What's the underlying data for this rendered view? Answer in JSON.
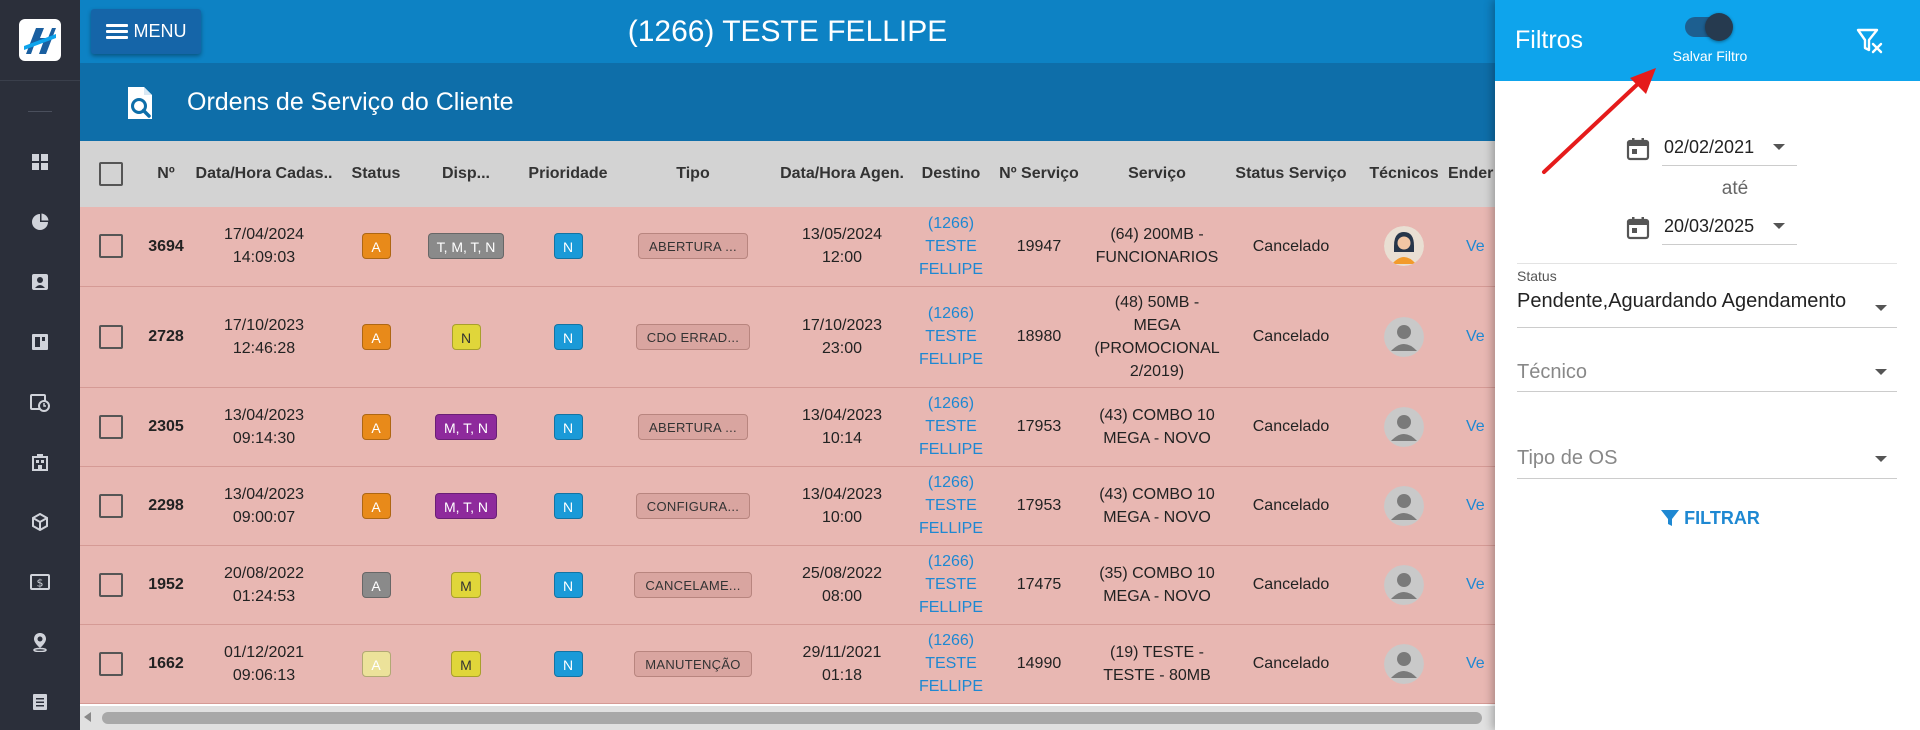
{
  "topbar": {
    "menu_label": "MENU",
    "client_title": "(1266) TESTE FELLIPE",
    "bg_color": "#0d82c4"
  },
  "subheader": {
    "page_title": "Ordens de Serviço do Cliente"
  },
  "sidebar": {
    "icons": [
      "grid-icon",
      "pie-chart-icon",
      "contact-card-icon",
      "dashboard-icon",
      "calendar-clock-icon",
      "building-icon",
      "box-icon",
      "money-icon",
      "map-pin-icon",
      "document-list-icon"
    ]
  },
  "table": {
    "headers": [
      "Nº",
      "Data/Hora Cadas..",
      "Status",
      "Disp...",
      "Prioridade",
      "Tipo",
      "Data/Hora Agen.",
      "Destino",
      "Nº Serviço",
      "Serviço",
      "Status Serviço",
      "Técnicos",
      "Ender"
    ],
    "rows": [
      {
        "num": "3694",
        "cad_date": "17/04/2024",
        "cad_time": "14:09:03",
        "status": "A",
        "status_color": "#e88a1a",
        "disp": "T, M, T, N",
        "disp_bg": "#8a8a8a",
        "disp_fg": "#ffffff",
        "prio": "N",
        "tipo": "ABERTURA ...",
        "ag_date": "13/05/2024",
        "ag_time": "12:00",
        "dest_1": "(1266)",
        "dest_2": "TESTE",
        "dest_3": "FELLIPE",
        "serv_num": "19947",
        "servico_1": "(64) 200MB -",
        "servico_2": "FUNCIONARIOS",
        "servico_3": "",
        "servico_4": "",
        "status_servico": "Cancelado",
        "tecnico_avatar": "woman-avatar",
        "endereco_link": "Ve"
      },
      {
        "num": "2728",
        "cad_date": "17/10/2023",
        "cad_time": "12:46:28",
        "status": "A",
        "status_color": "#e88a1a",
        "disp": "N",
        "disp_bg": "#e0d63a",
        "disp_fg": "#333333",
        "prio": "N",
        "tipo": "CDO ERRAD...",
        "ag_date": "17/10/2023",
        "ag_time": "23:00",
        "dest_1": "(1266)",
        "dest_2": "TESTE",
        "dest_3": "FELLIPE",
        "serv_num": "18980",
        "servico_1": "(48) 50MB -",
        "servico_2": "MEGA",
        "servico_3": "(PROMOCIONAL",
        "servico_4": "2/2019)",
        "status_servico": "Cancelado",
        "tecnico_avatar": "default-avatar",
        "endereco_link": "Ve"
      },
      {
        "num": "2305",
        "cad_date": "13/04/2023",
        "cad_time": "09:14:30",
        "status": "A",
        "status_color": "#e88a1a",
        "disp": "M, T, N",
        "disp_bg": "#8e2a9c",
        "disp_fg": "#ffffff",
        "prio": "N",
        "tipo": "ABERTURA ...",
        "ag_date": "13/04/2023",
        "ag_time": "10:14",
        "dest_1": "(1266)",
        "dest_2": "TESTE",
        "dest_3": "FELLIPE",
        "serv_num": "17953",
        "servico_1": "(43) COMBO 10",
        "servico_2": "MEGA - NOVO",
        "servico_3": "",
        "servico_4": "",
        "status_servico": "Cancelado",
        "tecnico_avatar": "default-avatar",
        "endereco_link": "Ve"
      },
      {
        "num": "2298",
        "cad_date": "13/04/2023",
        "cad_time": "09:00:07",
        "status": "A",
        "status_color": "#e88a1a",
        "disp": "M, T, N",
        "disp_bg": "#8e2a9c",
        "disp_fg": "#ffffff",
        "prio": "N",
        "tipo": "CONFIGURA...",
        "ag_date": "13/04/2023",
        "ag_time": "10:00",
        "dest_1": "(1266)",
        "dest_2": "TESTE",
        "dest_3": "FELLIPE",
        "serv_num": "17953",
        "servico_1": "(43) COMBO 10",
        "servico_2": "MEGA - NOVO",
        "servico_3": "",
        "servico_4": "",
        "status_servico": "Cancelado",
        "tecnico_avatar": "default-avatar",
        "endereco_link": "Ve"
      },
      {
        "num": "1952",
        "cad_date": "20/08/2022",
        "cad_time": "01:24:53",
        "status": "A",
        "status_color": "#8a8a8a",
        "disp": "M",
        "disp_bg": "#e0d63a",
        "disp_fg": "#333333",
        "prio": "N",
        "tipo": "CANCELAME...",
        "ag_date": "25/08/2022",
        "ag_time": "08:00",
        "dest_1": "(1266)",
        "dest_2": "TESTE",
        "dest_3": "FELLIPE",
        "serv_num": "17475",
        "servico_1": "(35) COMBO 10",
        "servico_2": "MEGA - NOVO",
        "servico_3": "",
        "servico_4": "",
        "status_servico": "Cancelado",
        "tecnico_avatar": "default-avatar",
        "endereco_link": "Ve"
      },
      {
        "num": "1662",
        "cad_date": "01/12/2021",
        "cad_time": "09:06:13",
        "status": "A",
        "status_color": "#ece29a",
        "disp": "M",
        "disp_bg": "#e0d63a",
        "disp_fg": "#333333",
        "prio": "N",
        "tipo": "MANUTENÇÃO",
        "ag_date": "29/11/2021",
        "ag_time": "01:18",
        "dest_1": "(1266)",
        "dest_2": "TESTE",
        "dest_3": "FELLIPE",
        "serv_num": "14990",
        "servico_1": "(19) TESTE -",
        "servico_2": "TESTE - 80MB",
        "servico_3": "",
        "servico_4": "",
        "status_servico": "Cancelado",
        "tecnico_avatar": "default-avatar",
        "endereco_link": "Ve"
      }
    ],
    "row_bg": "#e8b7b2",
    "prio_color": "#1a9ad8"
  },
  "filter_panel": {
    "title": "Filtros",
    "save_filter_label": "Salvar Filtro",
    "save_filter_enabled": true,
    "date_from": "02/02/2021",
    "ate_label": "até",
    "date_to": "20/03/2025",
    "status_label": "Status",
    "status_value": "Pendente,Aguardando Agendamento",
    "tecnico_placeholder": "Técnico",
    "tipo_os_placeholder": "Tipo de OS",
    "filtrar_label": "FILTRAR",
    "header_color": "#0ea4ec"
  },
  "annotation": {
    "arrow_color": "#e51b1b"
  }
}
